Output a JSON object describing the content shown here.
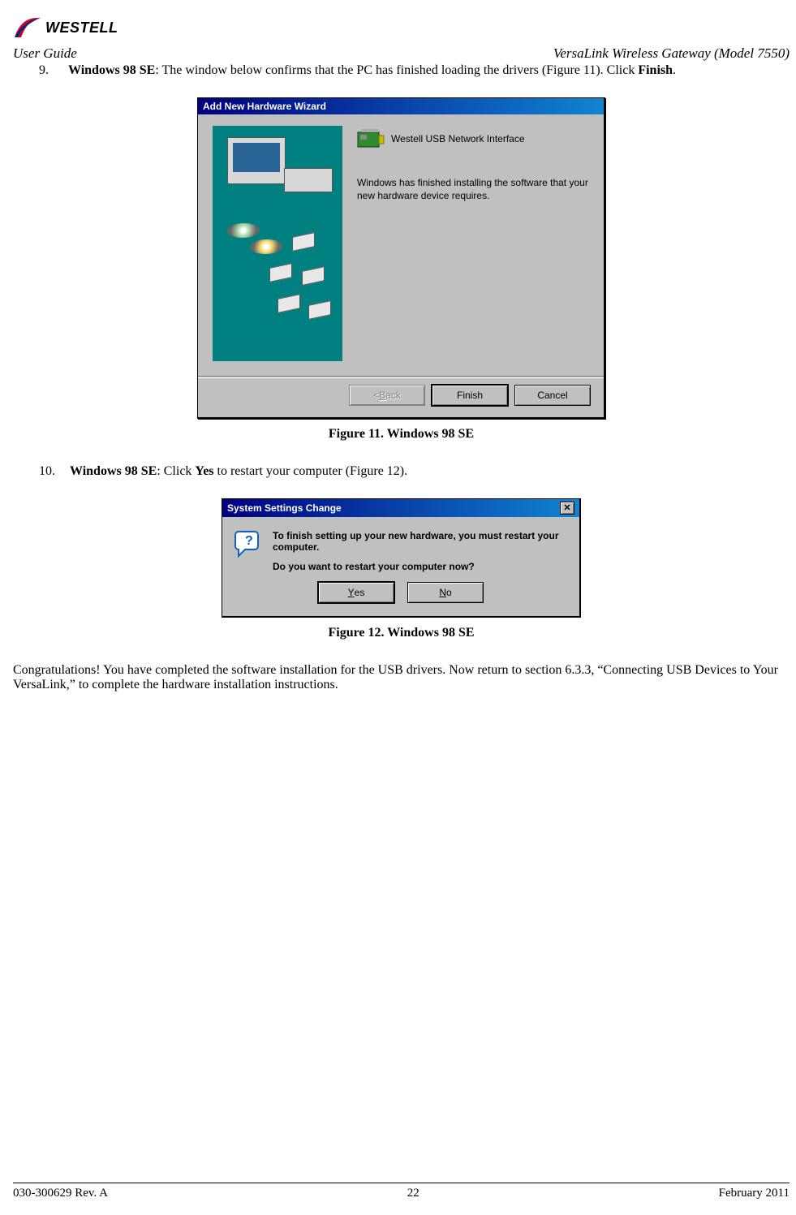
{
  "header": {
    "brand": "WESTELL",
    "left": "User Guide",
    "right": "VersaLink Wireless Gateway (Model 7550)"
  },
  "step9": {
    "num": "9.",
    "bold1": "Windows 98 SE",
    "text1": ": The window below confirms that the PC has finished loading the drivers (Figure 11). Click ",
    "bold2": "Finish",
    "text2": "."
  },
  "wizard": {
    "title": "Add New Hardware Wizard",
    "device": "Westell USB Network Interface",
    "msg": "Windows has finished installing the software that your new hardware device requires.",
    "back": "< Back",
    "finish": "Finish",
    "cancel": "Cancel"
  },
  "caption11": "Figure 11.  Windows 98 SE",
  "step10": {
    "num": "10.",
    "bold1": "Windows 98 SE",
    "text1": ": Click ",
    "bold2": "Yes",
    "text2": " to restart your computer (Figure 12)."
  },
  "dialog": {
    "title": "System Settings Change",
    "line1": "To finish setting up your new hardware, you must restart your computer.",
    "line2": "Do you want to restart your computer now?",
    "yes": "Yes",
    "no": "No"
  },
  "caption12": "Figure 12.  Windows 98 SE",
  "congrats": "Congratulations! You have completed the software installation for the USB drivers. Now return to section 6.3.3, “Connecting USB Devices to Your VersaLink,” to complete the hardware installation instructions.",
  "footer": {
    "left": "030-300629 Rev. A",
    "center": "22",
    "right": "February 2011"
  }
}
